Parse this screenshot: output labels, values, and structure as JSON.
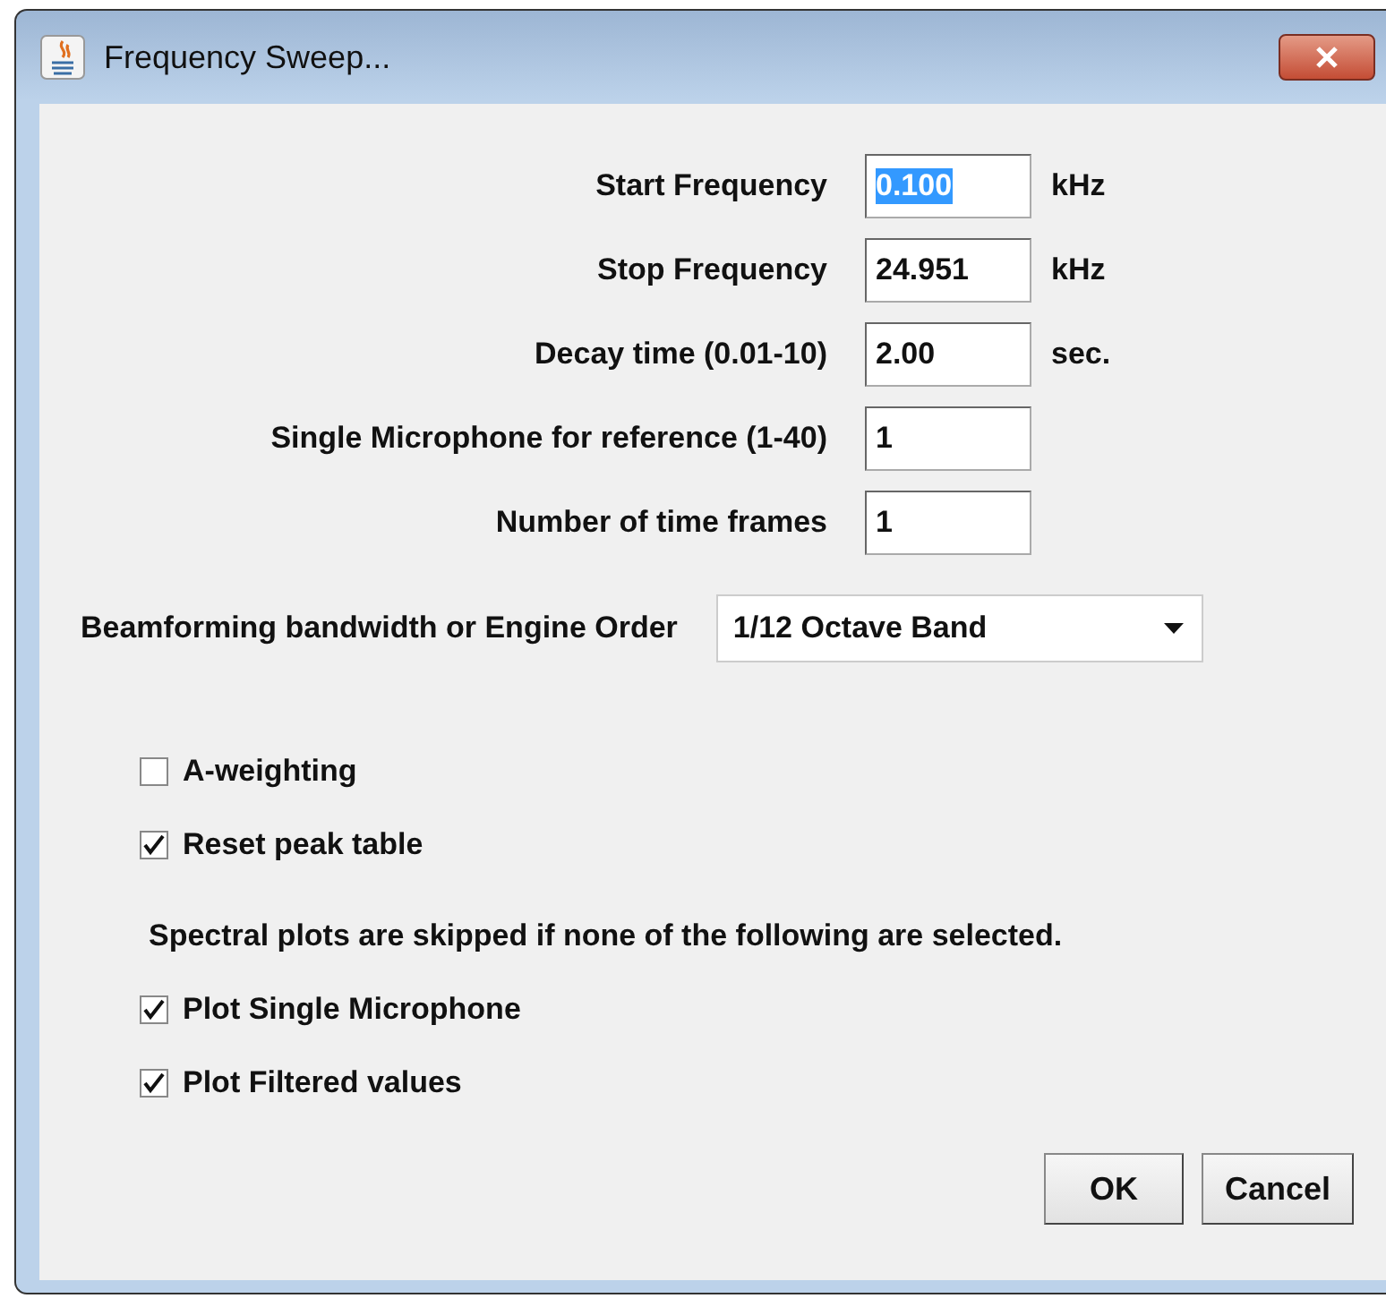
{
  "window": {
    "title": "Frequency Sweep..."
  },
  "fields": [
    {
      "label": "Start Frequency",
      "value": "0.100",
      "unit": "kHz",
      "text_selected": true
    },
    {
      "label": "Stop Frequency",
      "value": "24.951",
      "unit": "kHz",
      "text_selected": false
    },
    {
      "label": "Decay time (0.01-10)",
      "value": "2.00",
      "unit": "sec.",
      "text_selected": false
    },
    {
      "label": "Single Microphone for reference (1-40)",
      "value": "1",
      "text_selected": false
    },
    {
      "label": "Number of time frames",
      "value": "1",
      "text_selected": false
    }
  ],
  "dropdown": {
    "label": "Beamforming bandwidth or Engine Order",
    "value": "1/12 Octave Band"
  },
  "options": [
    {
      "label": "A-weighting",
      "checked": false
    },
    {
      "label": "Reset peak table",
      "checked": true
    }
  ],
  "note": "Spectral plots are skipped if none of the following are selected.",
  "plots": [
    {
      "label": "Plot Single Microphone",
      "checked": true
    },
    {
      "label": "Plot Filtered values",
      "checked": true
    }
  ],
  "buttons": [
    "OK",
    "Cancel"
  ]
}
